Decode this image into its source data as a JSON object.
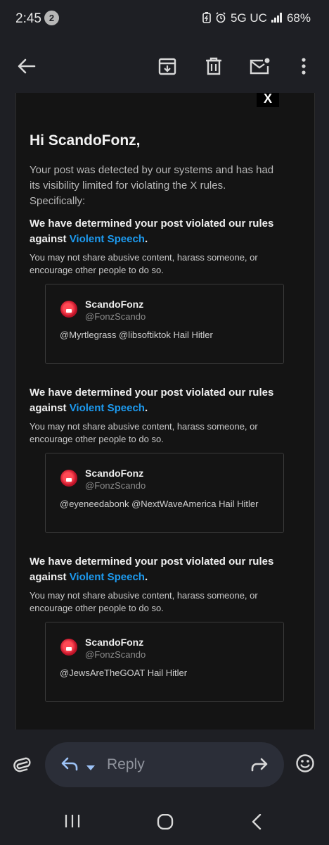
{
  "status_bar": {
    "time": "2:45",
    "notification_count": "2",
    "network": "5G UC",
    "battery": "68%"
  },
  "app_bar": {
    "icons": [
      "back-arrow-icon",
      "archive-icon",
      "delete-icon",
      "mark-unread-icon",
      "more-icon"
    ]
  },
  "email": {
    "brand_logo": "X",
    "greeting": "Hi ScandoFonz,",
    "intro": "Your post was detected by our systems and has had its visibility limited for violating the X rules. Specifically:",
    "violations": [
      {
        "heading_prefix": "We have determined your post violated our rules against ",
        "rule_link": "Violent Speech",
        "heading_suffix": ".",
        "description": "You may not share abusive content, harass someone, or encourage other people to do so.",
        "post": {
          "name": "ScandoFonz",
          "handle": "@FonzScando",
          "text": "@Myrtlegrass @libsoftiktok Hail Hitler"
        }
      },
      {
        "heading_prefix": "We have determined your post violated our rules against ",
        "rule_link": "Violent Speech",
        "heading_suffix": ".",
        "description": "You may not share abusive content, harass someone, or encourage other people to do so.",
        "post": {
          "name": "ScandoFonz",
          "handle": "@FonzScando",
          "text": "@eyeneedabonk @NextWaveAmerica Hail Hitler"
        }
      },
      {
        "heading_prefix": "We have determined your post violated our rules against ",
        "rule_link": "Violent Speech",
        "heading_suffix": ".",
        "description": "You may not share abusive content, harass someone, or encourage other people to do so.",
        "post": {
          "name": "ScandoFonz",
          "handle": "@FonzScando",
          "text": "@JewsAreTheGOAT Hail Hitler"
        }
      }
    ]
  },
  "reply_bar": {
    "placeholder": "Reply"
  },
  "colors": {
    "link": "#1d9bf0",
    "background": "#1e1f24",
    "mail_background": "#141414"
  }
}
